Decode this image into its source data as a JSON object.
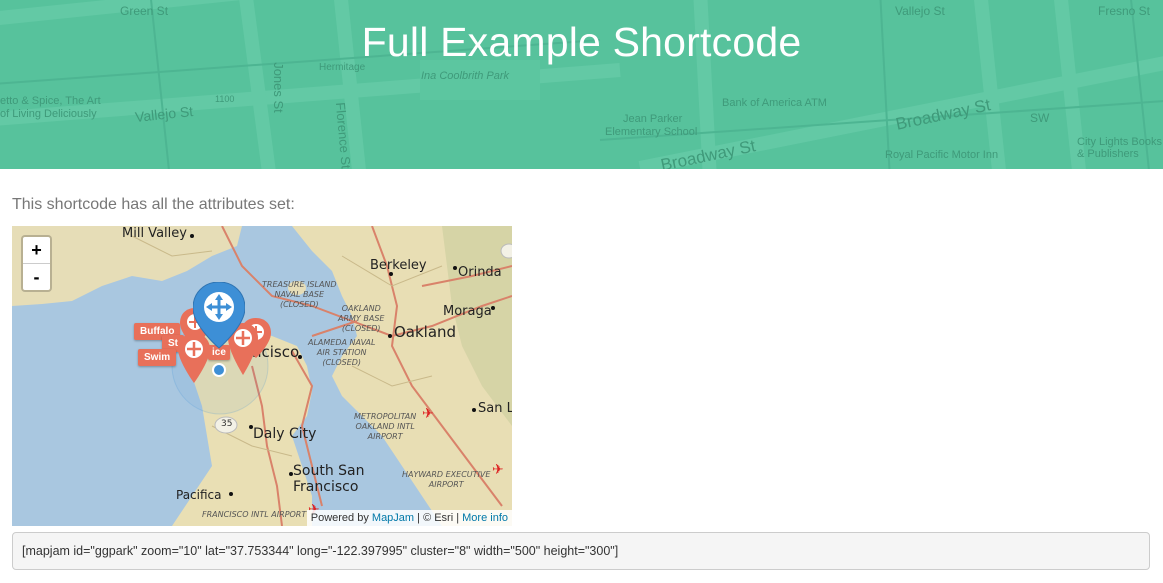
{
  "header": {
    "title": "Full Example Shortcode",
    "background_color": "#57c29c",
    "map_labels": {
      "green_st": "Green St",
      "vallejo_st_top": "Vallejo St",
      "fresno_st": "Fresno St",
      "hermitage": "Hermitage",
      "ina_coolbrith_park": "Ina Coolbrith Park",
      "spice": "etto & Spice, The Art",
      "living": "of Living Deliciously",
      "vallejo_st": "Vallejo St",
      "number_1100": "1100",
      "jones_st": "Jones St",
      "florence_st": "Florence St",
      "bank_atm": "Bank of America ATM",
      "jean_parker": "Jean Parker",
      "elementary": "Elementary School",
      "broadway_st": "Broadway St",
      "broadway_st2": "Broadway St",
      "sw": "SW",
      "royal_pacific": "Royal Pacific Motor Inn",
      "city_lights": "City Lights Books",
      "publishers": "& Publishers"
    }
  },
  "intro_text": "This shortcode has all the attributes set:",
  "map": {
    "zoom_in": "+",
    "zoom_out": "-",
    "places": {
      "mill_valley": "Mill Valley",
      "berkeley": "Berkeley",
      "orinda": "Orinda",
      "moraga": "Moraga",
      "oakland": "Oakland",
      "treasure_island": "TREASURE ISLAND\nNAVAL BASE\n(CLOSED)",
      "oakland_army": "OAKLAND\nARMY BASE\n(CLOSED)",
      "alameda": "ALAMEDA NAVAL\nAIR STATION\n(CLOSED)",
      "francisco": "ncisco",
      "metro_oakland": "METROPOLITAN\nOAKLAND INTL\nAIRPORT",
      "san_l": "San L",
      "daly_city": "Daly City",
      "south_san": "South San",
      "francisco2": "Francisco",
      "hayward": "HAYWARD EXECUTIVE\nAIRPORT",
      "pacifica": "Pacifica",
      "sfo": "FRANCISCO INTL AIRPORT",
      "route_35": "35"
    },
    "markers": {
      "buffalo": "Buffalo",
      "st": "St",
      "ice": "ice",
      "swim": "Swim"
    },
    "attribution": {
      "powered_by": "Powered by ",
      "mapjam": "MapJam",
      "esri": " | © Esri | ",
      "more_info": "More info"
    },
    "marker_color": "#e8705a",
    "center_marker_color": "#3d8fd6"
  },
  "code_block": "[mapjam id=\"ggpark\" zoom=\"10\" lat=\"37.753344\" long=\"-122.397995\" cluster=\"8\" width=\"500\" height=\"300\"]"
}
